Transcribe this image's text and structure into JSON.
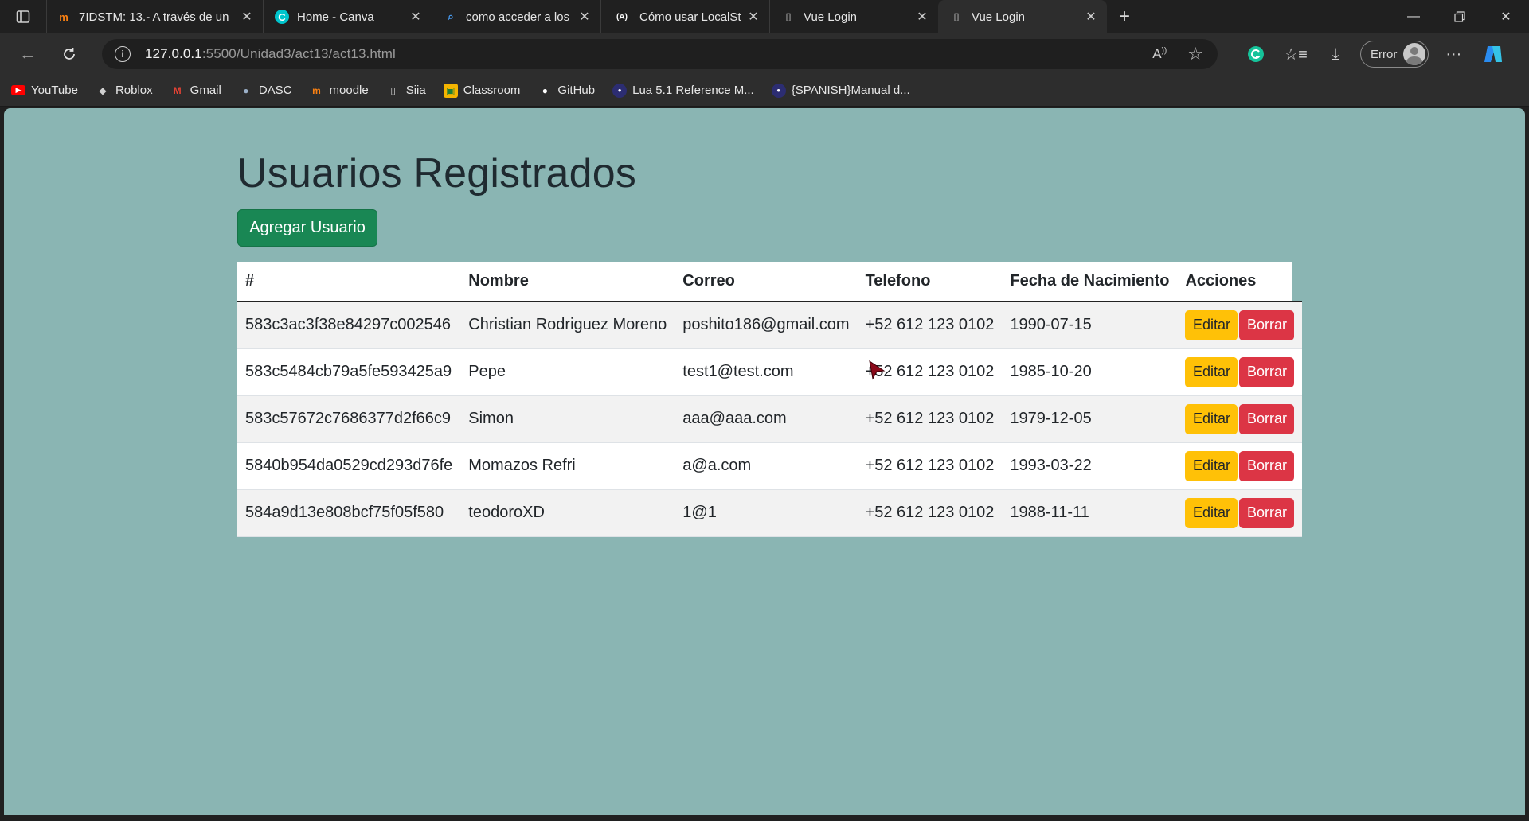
{
  "browser": {
    "tabs": [
      {
        "title": "7IDSTM: 13.- A través de un",
        "icon": "moodle-icon",
        "icon_color": "#f98012",
        "active": false
      },
      {
        "title": "Home - Canva",
        "icon": "canva-icon",
        "icon_color": "#00c4cc",
        "active": false
      },
      {
        "title": "como acceder a los datos qu",
        "icon": "search-icon",
        "icon_color": "#4aa3ff",
        "active": false
      },
      {
        "title": "Cómo usar LocalStorage en",
        "icon": "ai-icon",
        "icon_color": "#ffffff",
        "active": false
      },
      {
        "title": "Vue Login",
        "icon": "page-icon",
        "icon_color": "#d0d0d0",
        "active": false
      },
      {
        "title": "Vue Login",
        "icon": "page-icon",
        "icon_color": "#d0d0d0",
        "active": true
      }
    ],
    "url_host": "127.0.0.1",
    "url_rest": ":5500/Unidad3/act13/act13.html",
    "profile_status": "Error",
    "bookmarks": [
      {
        "label": "YouTube",
        "icon": "youtube-icon",
        "color": "#ff0000"
      },
      {
        "label": "Roblox",
        "icon": "roblox-icon",
        "color": "#d0d0d0"
      },
      {
        "label": "Gmail",
        "icon": "gmail-icon",
        "color": "#ea4335"
      },
      {
        "label": "DASC",
        "icon": "dasc-icon",
        "color": "#9bb0c8"
      },
      {
        "label": "moodle",
        "icon": "moodle-icon",
        "color": "#f98012"
      },
      {
        "label": "Siia",
        "icon": "page-icon",
        "color": "#d0d0d0"
      },
      {
        "label": "Classroom",
        "icon": "classroom-icon",
        "color": "#f4b400"
      },
      {
        "label": "GitHub",
        "icon": "github-icon",
        "color": "#ffffff"
      },
      {
        "label": "Lua 5.1 Reference M...",
        "icon": "lua-icon",
        "color": "#2c2d72"
      },
      {
        "label": "{SPANISH}Manual d...",
        "icon": "lua-icon",
        "color": "#2c2d72"
      }
    ]
  },
  "page": {
    "title": "Usuarios Registrados",
    "add_button": "Agregar Usuario",
    "columns": [
      "#",
      "Nombre",
      "Correo",
      "Telefono",
      "Fecha de Nacimiento",
      "Acciones"
    ],
    "edit_label": "Editar",
    "delete_label": "Borrar",
    "rows": [
      {
        "id": "583c3ac3f38e84297c002546",
        "nombre": "Christian Rodriguez Moreno",
        "correo": "poshito186@gmail.com",
        "telefono": "+52 612 123 0102",
        "fecha": "1990-07-15"
      },
      {
        "id": "583c5484cb79a5fe593425a9",
        "nombre": "Pepe",
        "correo": "test1@test.com",
        "telefono": "+52 612 123 0102",
        "fecha": "1985-10-20"
      },
      {
        "id": "583c57672c7686377d2f66c9",
        "nombre": "Simon",
        "correo": "aaa@aaa.com",
        "telefono": "+52 612 123 0102",
        "fecha": "1979-12-05"
      },
      {
        "id": "5840b954da0529cd293d76fe",
        "nombre": "Momazos Refri",
        "correo": "a@a.com",
        "telefono": "+52 612 123 0102",
        "fecha": "1993-03-22"
      },
      {
        "id": "584a9d13e808bcf75f05f580",
        "nombre": "teodoroXD",
        "correo": "1@1",
        "telefono": "+52 612 123 0102",
        "fecha": "1988-11-11"
      }
    ]
  },
  "colors": {
    "page_background": "#8ab5b3",
    "add_button": "#198754",
    "edit_button": "#ffc107",
    "delete_button": "#dc3545"
  }
}
